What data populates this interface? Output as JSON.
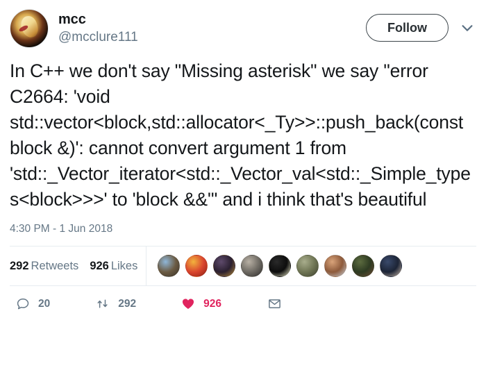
{
  "account": {
    "display_name": "mcc",
    "handle": "@mcclure111",
    "avatar_icon": "avatar-image"
  },
  "header": {
    "follow_label": "Follow",
    "caret_icon": "chevron-down-icon",
    "accent_color": "#1da1f2",
    "caret_color": "#5b7083"
  },
  "tweet": {
    "text": "In C++ we don't say \"Missing asterisk\" we say \"error C2664: 'void std::vector<block,std::allocator<_Ty>>::push_back(const block &)': cannot convert argument 1 from 'std::_Vector_iterator<std::_Vector_val<std::_Simple_types<block>>>' to 'block &&'\" and i think that's beautiful",
    "timestamp": "4:30 PM - 1 Jun 2018"
  },
  "stats": {
    "retweets_count": "292",
    "retweets_label": "Retweets",
    "likes_count": "926",
    "likes_label": "Likes",
    "liker_avatars": [
      {
        "name": "liker-avatar-1",
        "color1": "#8fb7d9",
        "color2": "#6b5b43",
        "color3": "#3b3328"
      },
      {
        "name": "liker-avatar-2",
        "color1": "#f2b33d",
        "color2": "#d9452e",
        "color3": "#8c1f14"
      },
      {
        "name": "liker-avatar-3",
        "color1": "#5e4a6b",
        "color2": "#2b2030",
        "color3": "#b58a3a"
      },
      {
        "name": "liker-avatar-4",
        "color1": "#b8b0a4",
        "color2": "#6e6a63",
        "color3": "#2e2c2a"
      },
      {
        "name": "liker-avatar-5",
        "color1": "#2a2a2a",
        "color2": "#0d0d0d",
        "color3": "#e8e8c8"
      },
      {
        "name": "liker-avatar-6",
        "color1": "#a8ad8c",
        "color2": "#6f7554",
        "color3": "#3e4230"
      },
      {
        "name": "liker-avatar-7",
        "color1": "#d9a37a",
        "color2": "#8d5a3b",
        "color3": "#c9d2da"
      },
      {
        "name": "liker-avatar-8",
        "color1": "#5c6b3f",
        "color2": "#2e3b22",
        "color3": "#6b4a33"
      },
      {
        "name": "liker-avatar-9",
        "color1": "#3a4a6b",
        "color2": "#1c2436",
        "color3": "#c9b8a8"
      }
    ]
  },
  "actions": {
    "reply_icon": "reply-icon",
    "reply_count": "20",
    "retweet_icon": "retweet-icon",
    "retweet_count": "292",
    "like_icon": "heart-icon",
    "like_count": "926",
    "dm_icon": "envelope-icon",
    "like_color": "#e0245e",
    "muted_color": "#657786"
  }
}
